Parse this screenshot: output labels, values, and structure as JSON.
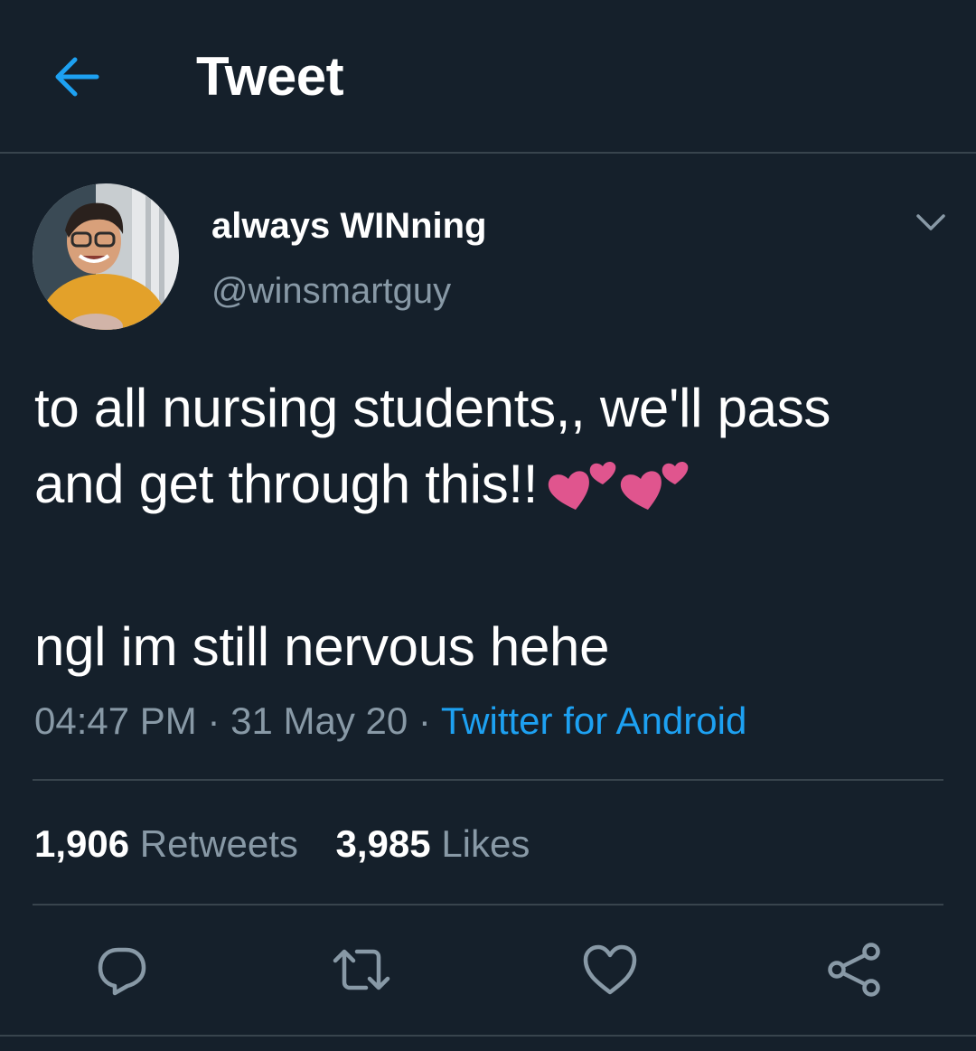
{
  "header": {
    "title": "Tweet",
    "back_icon": "arrow-left-icon",
    "accent_color": "#1da1f2"
  },
  "tweet": {
    "author": {
      "display_name": "always WINning",
      "handle": "@winsmartguy",
      "avatar_icon": "profile-photo"
    },
    "more_icon": "chevron-down-icon",
    "text_lines": [
      "to all nursing students,, we'll pass",
      "and get through this!!"
    ],
    "text_line_last": "ngl im still nervous hehe",
    "emoji": "two-hearts-emoji",
    "time": "04:47 PM",
    "date": "31 May 20",
    "separator": "·",
    "source": "Twitter for Android",
    "stats": {
      "retweets_count": "1,906",
      "retweets_label": "Retweets",
      "likes_count": "3,985",
      "likes_label": "Likes"
    }
  },
  "actions": [
    {
      "icon": "reply-icon"
    },
    {
      "icon": "retweet-icon"
    },
    {
      "icon": "like-icon"
    },
    {
      "icon": "share-icon"
    }
  ],
  "colors": {
    "background": "#15202b",
    "divider": "#38444d",
    "secondary_text": "#8899a6",
    "link": "#1da1f2",
    "heart_pink": "#e0558e"
  }
}
